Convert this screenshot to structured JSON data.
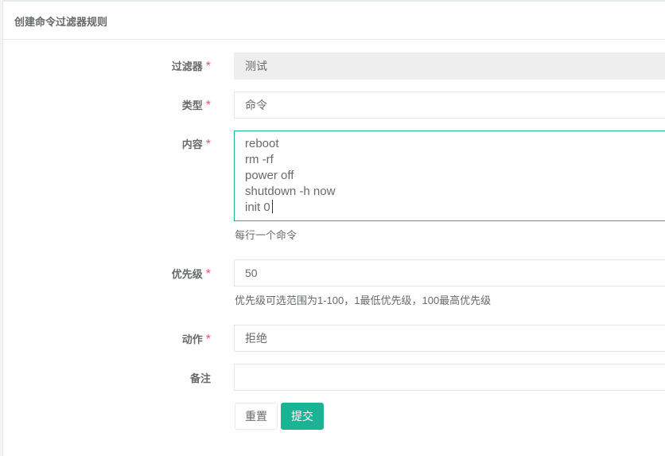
{
  "panel": {
    "title": "创建命令过滤器规则"
  },
  "form": {
    "required_mark": "*",
    "filter": {
      "label": "过滤器",
      "value": "测试"
    },
    "type": {
      "label": "类型",
      "value": "命令"
    },
    "content": {
      "label": "内容",
      "lines": [
        "reboot",
        "rm -rf",
        "power off",
        "shutdown -h now",
        "init 0"
      ],
      "help": "每行一个命令"
    },
    "priority": {
      "label": "优先级",
      "value": "50",
      "help": "优先级可选范围为1-100，1最低优先级，100最高优先级"
    },
    "action": {
      "label": "动作",
      "value": "拒绝"
    },
    "comment": {
      "label": "备注",
      "value": ""
    },
    "buttons": {
      "reset": "重置",
      "submit": "提交"
    }
  },
  "colors": {
    "accent": "#1ab394",
    "required": "#ed5565"
  }
}
